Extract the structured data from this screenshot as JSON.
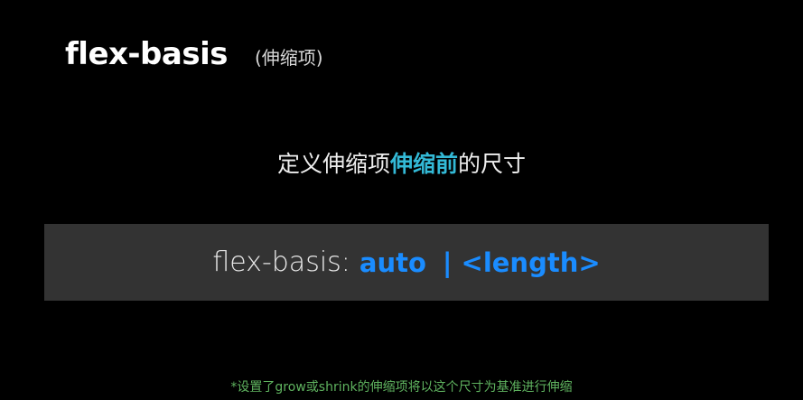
{
  "slide": {
    "title": "flex-basis",
    "title_note": "(伸缩项)",
    "definition": {
      "before": "定义伸缩项",
      "highlight": "伸缩前",
      "after": "的尺寸"
    },
    "syntax": {
      "property": "flex-basis:",
      "value_auto": "auto",
      "separator": "|",
      "value_length": "<length>"
    },
    "footnote": "*设置了grow或shrink的伸缩项将以这个尺寸为基准进行伸缩"
  },
  "colors": {
    "background": "#000000",
    "highlight_cyan": "#33b9d6",
    "syntax_blue": "#1a8cff",
    "syntax_box": "#333333",
    "footnote_green": "#5fb35f"
  }
}
